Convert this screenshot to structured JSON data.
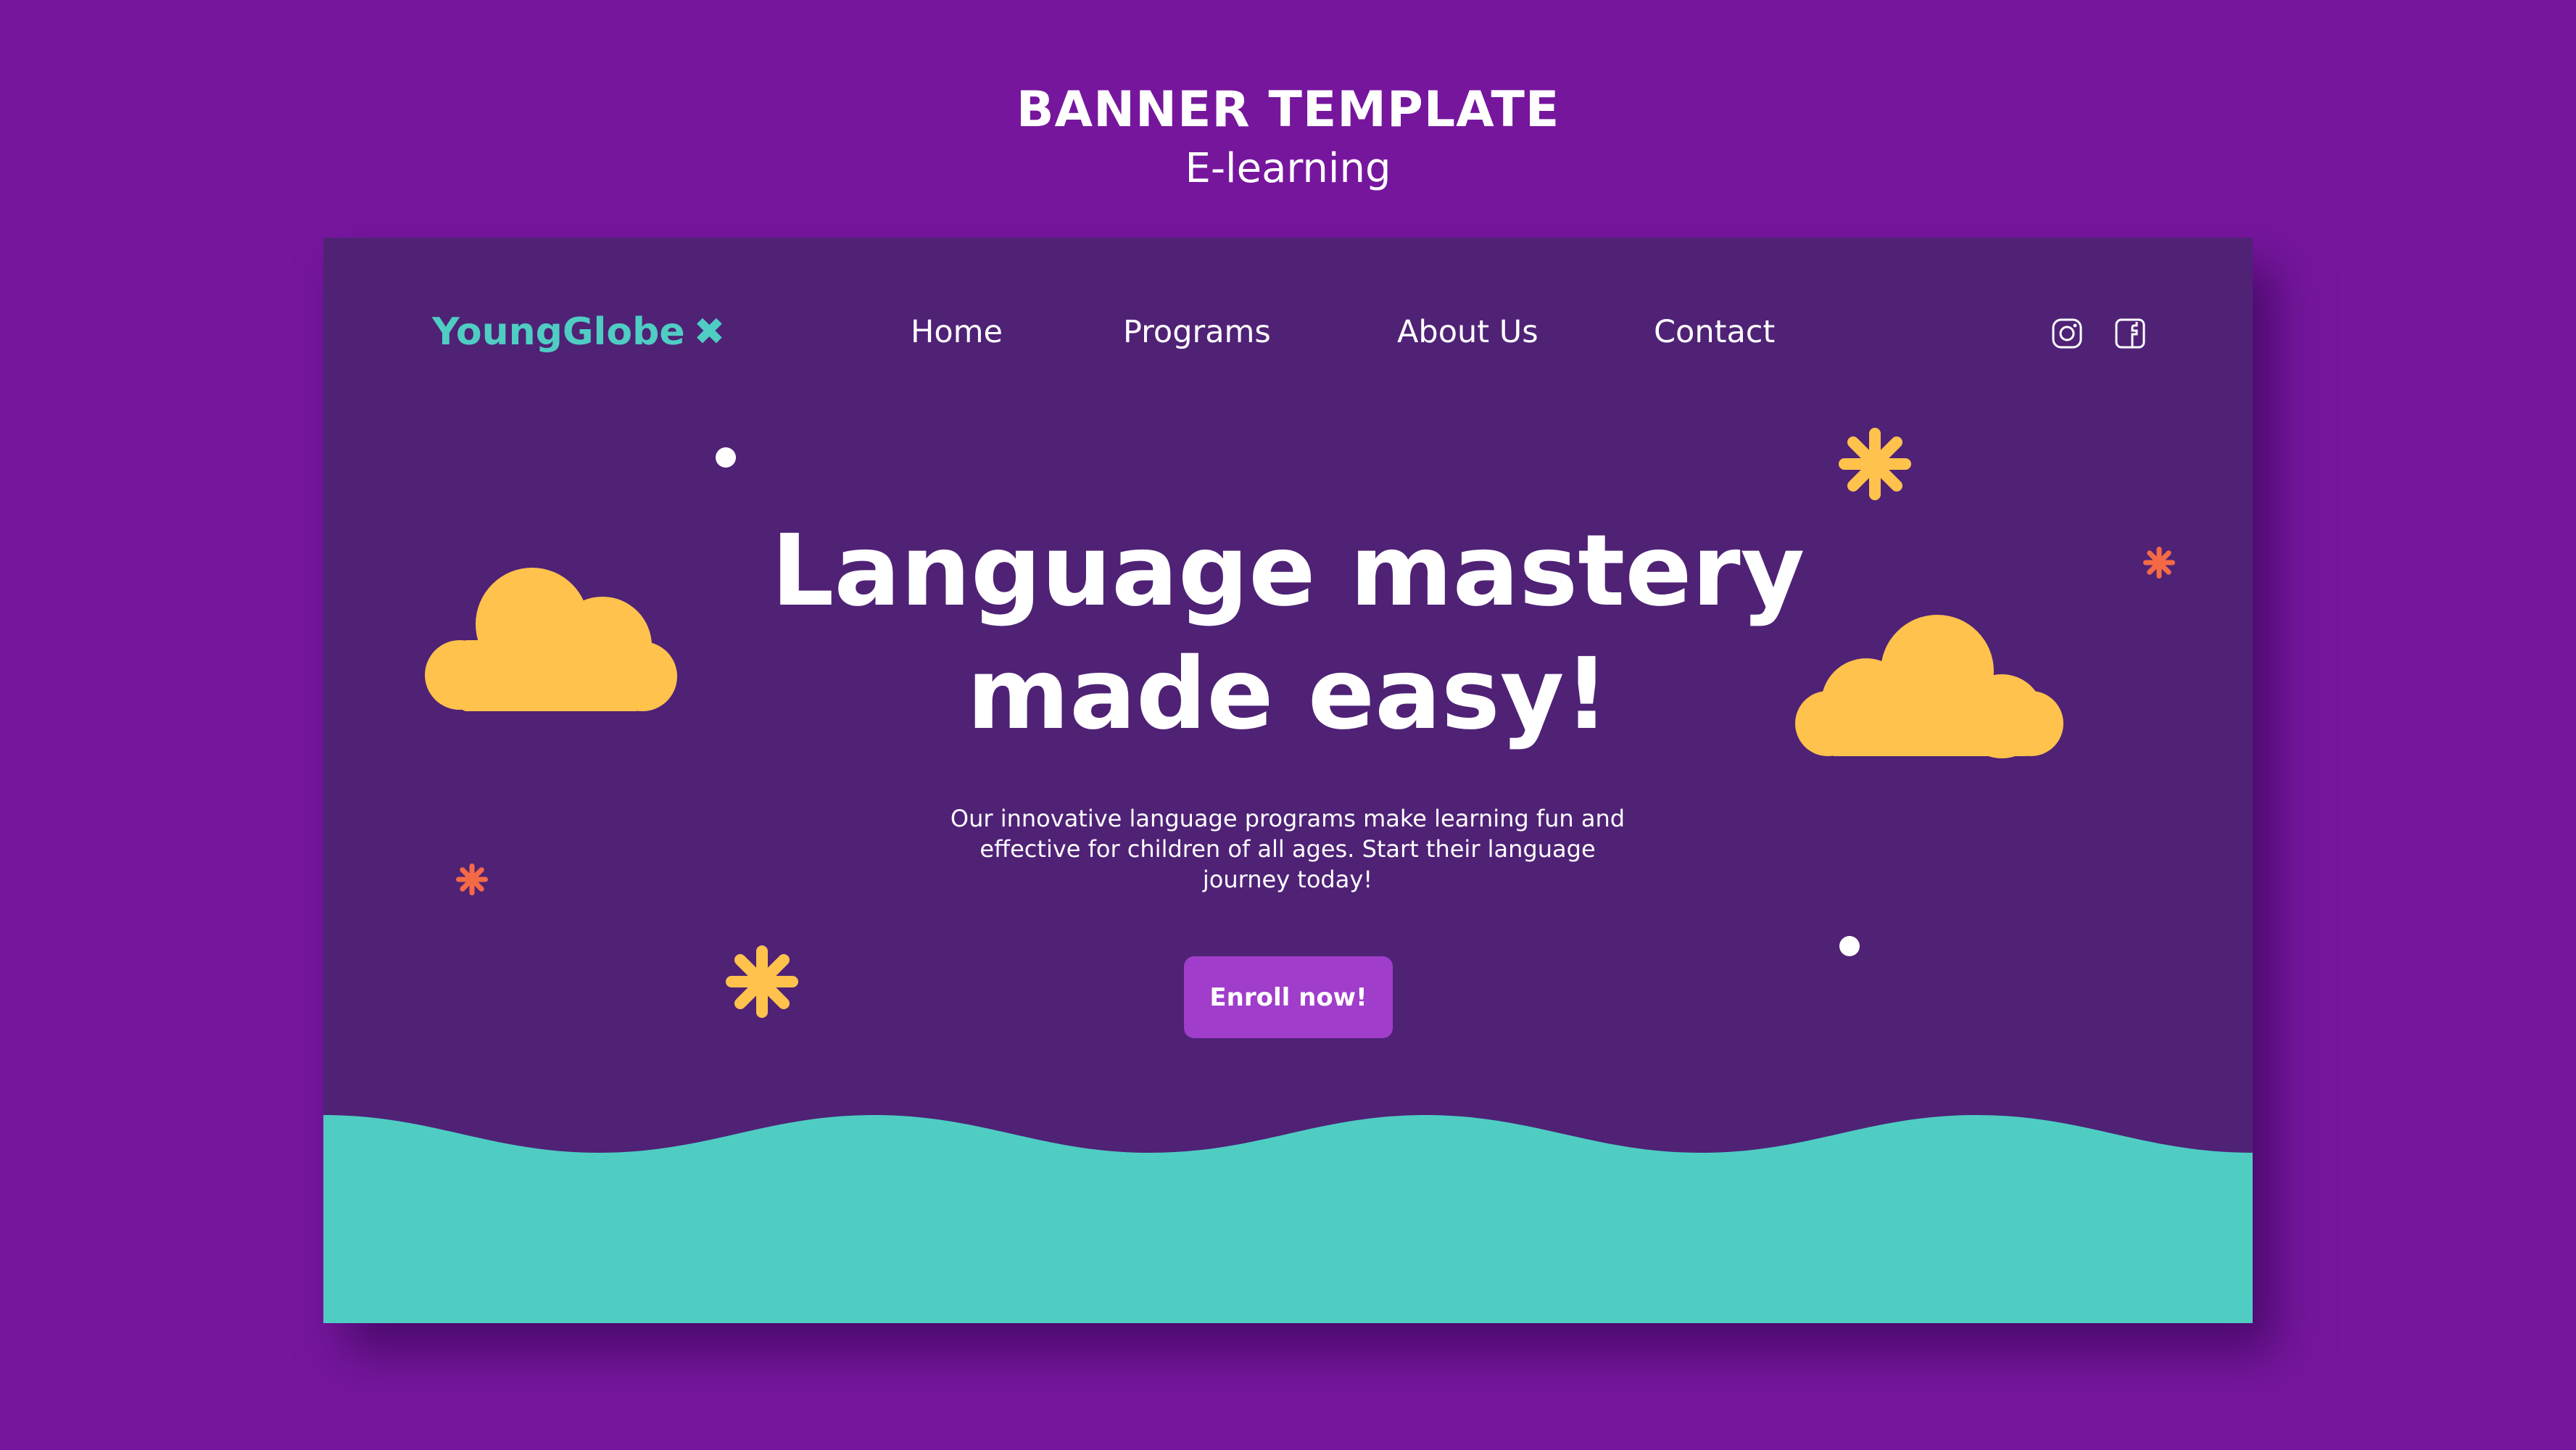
{
  "header": {
    "title": "BANNER TEMPLATE",
    "subtitle": "E-learning"
  },
  "banner": {
    "logo": {
      "text": "YoungGlobe",
      "mark": "✖"
    },
    "nav": [
      "Home",
      "Programs",
      "About Us",
      "Contact"
    ],
    "social": [
      "instagram-icon",
      "facebook-icon"
    ],
    "headline": {
      "line1": "Language mastery",
      "line2": "made easy!"
    },
    "description": "Our innovative language programs make learning fun and effective for children of all ages. Start their language journey today!",
    "cta_label": "Enroll now!"
  },
  "colors": {
    "page_background": "#76169d",
    "banner_background": "#4f2276",
    "accent_teal": "#4fcdc3",
    "cloud_yellow": "#ffc24d",
    "button_purple": "#a03dca",
    "sparkle_orange": "#f36a45"
  }
}
